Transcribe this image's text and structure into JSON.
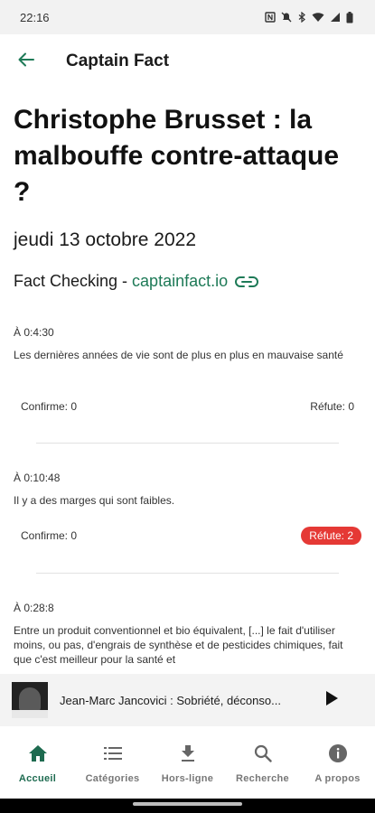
{
  "status_bar": {
    "time": "22:16",
    "icons": [
      "nfc-icon",
      "mute-icon",
      "bluetooth-icon",
      "wifi-icon",
      "signal-icon",
      "battery-icon"
    ]
  },
  "app_bar": {
    "back_icon": "arrow-back-icon",
    "title": "Captain Fact"
  },
  "video": {
    "title": "Christophe Brusset : la malbouffe contre-attaque ?",
    "date": "jeudi 13 octobre 2022",
    "fact_checking_label": "Fact Checking -",
    "fact_checking_link": "captainfact.io",
    "link_icon": "link-icon"
  },
  "facts": [
    {
      "time": "À 0:4:30",
      "text": "Les dernières années de vie sont de plus en plus en mauvaise santé",
      "confirm": "Confirme: 0",
      "refute": "Réfute: 0"
    },
    {
      "time": "À 0:10:48",
      "text": "Il y a des marges qui sont faibles.",
      "confirm": "Confirme: 0",
      "refute": "Réfute: 2"
    },
    {
      "time": "À 0:28:8",
      "text": "Entre un produit conventionnel et bio équivalent, [...] le fait d'utiliser moins, ou pas, d'engrais de synthèse et de pesticides chimiques, fait que c'est meilleur pour la santé et"
    }
  ],
  "mini_player": {
    "title": "Jean-Marc Jancovici : Sobriété, déconso...",
    "play_icon": "play-icon"
  },
  "bottom_nav": [
    {
      "label": "Accueil",
      "icon": "home-icon",
      "active": true
    },
    {
      "label": "Catégories",
      "icon": "list-icon",
      "active": false
    },
    {
      "label": "Hors-ligne",
      "icon": "download-icon",
      "active": false
    },
    {
      "label": "Recherche",
      "icon": "search-icon",
      "active": false
    },
    {
      "label": "A propos",
      "icon": "info-icon",
      "active": false
    }
  ],
  "colors": {
    "accent": "#1e7a57",
    "nav_active": "#1e6b50",
    "refute_badge": "#e53935"
  }
}
